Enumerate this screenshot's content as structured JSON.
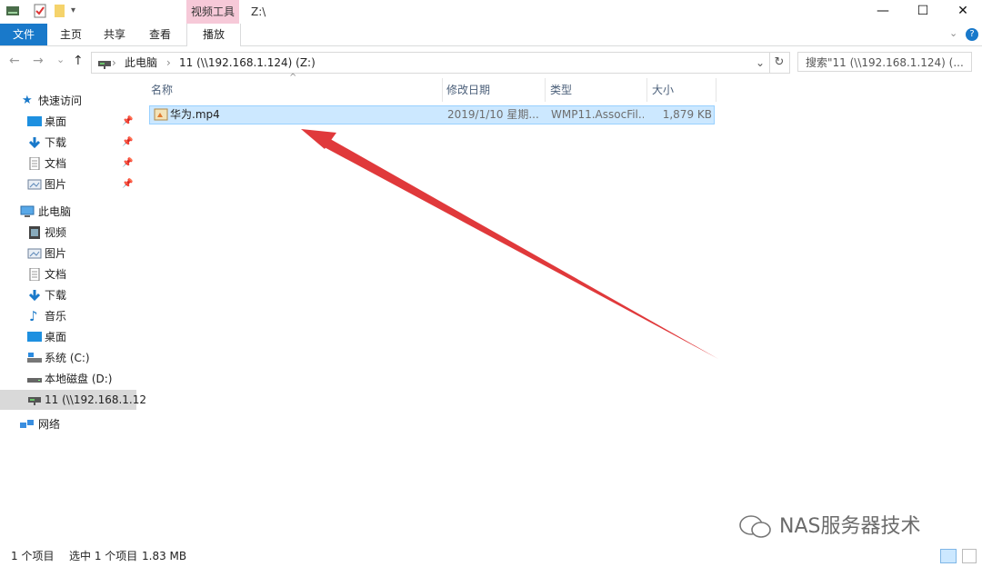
{
  "titlebar": {
    "context_tab": "视频工具",
    "window_title": "Z:\\",
    "minimize": "—",
    "maximize": "☐",
    "close": "✕"
  },
  "ribbon": {
    "tabs": [
      "文件",
      "主页",
      "共享",
      "查看",
      "播放"
    ]
  },
  "address": {
    "back": "←",
    "forward": "→",
    "recent": "⌄",
    "up": "↑",
    "crumbs": [
      "此电脑",
      "›",
      "11 (\\\\192.168.1.124) (Z:)"
    ],
    "search_placeholder": "搜索\"11 (\\\\192.168.1.124) (..."
  },
  "nav": {
    "quick_access": "快速访问",
    "quick_items": [
      "桌面",
      "下载",
      "文档",
      "图片"
    ],
    "this_pc": "此电脑",
    "pc_items": [
      "视频",
      "图片",
      "文档",
      "下载",
      "音乐",
      "桌面",
      "系统 (C:)",
      "本地磁盘 (D:)",
      "11 (\\\\192.168.1.12"
    ],
    "network": "网络"
  },
  "columns": {
    "name": "名称",
    "modified": "修改日期",
    "type": "类型",
    "size": "大小"
  },
  "files": [
    {
      "name": "华为.mp4",
      "modified": "2019/1/10 星期...",
      "type": "WMP11.AssocFil...",
      "size": "1,879 KB"
    }
  ],
  "status": {
    "count": "1 个项目",
    "selected": "选中 1 个项目",
    "selsize": "1.83 MB"
  },
  "watermark": "NAS服务器技术",
  "colors": {
    "accent": "#1979ca",
    "selection": "#cce8ff",
    "arrow": "#e0393b",
    "context_tab": "#f6c9d8"
  }
}
